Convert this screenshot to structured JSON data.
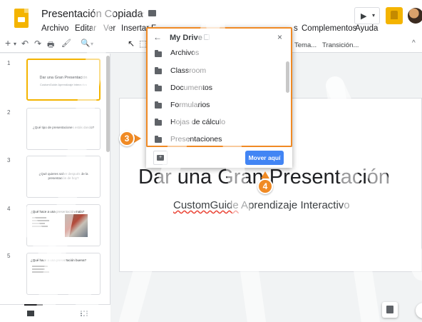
{
  "header": {
    "doc_title": "Presentación Copiada",
    "star_glyph": "☆",
    "menus": [
      "Archivo",
      "Editar",
      "Ver",
      "Insertar",
      "F"
    ],
    "menus_right": [
      "s",
      "Complementos",
      "Ayuda"
    ],
    "present_glyph": "▶",
    "present_caret": "▾"
  },
  "toolbar": {
    "glyphs": [
      "+",
      "▾",
      "↶",
      "↷",
      "🖶",
      "🖌",
      "🔍",
      "▾",
      "↖",
      "⬚"
    ],
    "tema": "Tema...",
    "transicion": "Transición...",
    "chevron": "^"
  },
  "filmstrip": {
    "slides": [
      {
        "num": "1",
        "title": "Dar una Gran Presentación",
        "sub": "CustomGuide Aprendizaje Interactivo"
      },
      {
        "num": "2",
        "title": "¿Qué tipo de presentaciones estás dando?"
      },
      {
        "num": "3",
        "title": "¿Qué quieres saber después de la presentación de hoy?"
      },
      {
        "num": "4",
        "title": "¿Qué hace a una presentación mala?"
      },
      {
        "num": "5",
        "title": "¿Qué hace a una presentación buena?"
      }
    ]
  },
  "slide": {
    "title": "Dar una Gran Presentación",
    "subtitle_a": "CustomGuide",
    "subtitle_b": " Aprendizaje Interactivo"
  },
  "dialog": {
    "back_glyph": "←",
    "title": "My Drive",
    "close_glyph": "×",
    "folders": [
      "Archivos",
      "Classroom",
      "Documentos",
      "Formularios",
      "Hojas de cálculo",
      "Presentaciones"
    ],
    "new_folder_glyph": "+",
    "move_here": "Mover aquí"
  },
  "callouts": {
    "step3": "3",
    "step4": "4"
  },
  "colors": {
    "accent": "#f08a24",
    "blue": "#4285f4",
    "slides_yellow": "#f4b400"
  }
}
